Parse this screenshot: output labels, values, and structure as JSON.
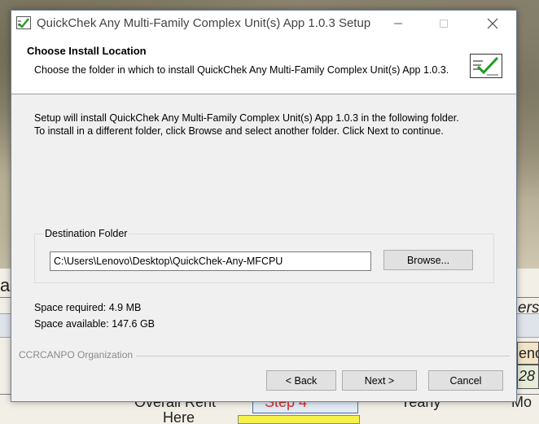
{
  "window": {
    "title": "QuickChek Any Multi-Family Complex Unit(s) App 1.0.3 Setup"
  },
  "header": {
    "title": "Choose Install Location",
    "subtitle": "Choose the folder in which to install QuickChek Any Multi-Family Complex Unit(s) App 1.0.3."
  },
  "body": {
    "line1": "Setup will install QuickChek Any Multi-Family Complex Unit(s) App 1.0.3 in the following folder.",
    "line2": "To install in a different folder, click Browse and select another folder. Click Next to continue."
  },
  "destination": {
    "label": "Destination Folder",
    "path": "C:\\Users\\Lenovo\\Desktop\\QuickChek-Any-MFCPU",
    "browse_label": "Browse..."
  },
  "space": {
    "required": "Space required: 4.9 MB",
    "available": "Space available: 147.6 GB"
  },
  "footer": {
    "brand": "CCRCANPO Organization",
    "back_label": "< Back",
    "next_label": "Next >",
    "cancel_label": "Cancel"
  },
  "background": {
    "frag_a": "a",
    "frag_ers": "ers",
    "frag_enc": "enc",
    "frag_28": "28",
    "frag_overall_rent": "Overall Rent",
    "frag_step4": "Step 4",
    "frag_yearly": "Yearly",
    "frag_mo": "Mo",
    "frag_here": "Here"
  },
  "icons": {
    "title_icon": "setup-check-icon",
    "header_logo": "quickchek-logo-icon",
    "minimize": "minimize-icon",
    "maximize": "maximize-icon",
    "close": "close-icon"
  },
  "colors": {
    "dialog_bg": "#f0f0f0",
    "header_bg": "#ffffff",
    "button_bg": "#e1e1e1",
    "brand_text": "#8a8a8a",
    "step_text": "#d03030"
  }
}
